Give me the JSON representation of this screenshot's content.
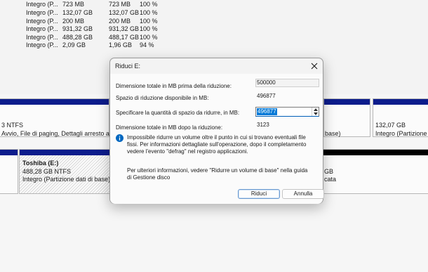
{
  "volumes": {
    "rows": [
      {
        "status": "Integro (P...",
        "capacity": "723 MB",
        "free": "723 MB",
        "pct": "100 %"
      },
      {
        "status": "Integro (P...",
        "capacity": "132,07 GB",
        "free": "132,07 GB",
        "pct": "100 %"
      },
      {
        "status": "Integro (P...",
        "capacity": "200 MB",
        "free": "200 MB",
        "pct": "100 %"
      },
      {
        "status": "Integro (P...",
        "capacity": "931,32 GB",
        "free": "931,32 GB",
        "pct": "100 %"
      },
      {
        "status": "Integro (P...",
        "capacity": "488,28 GB",
        "free": "488,17 GB",
        "pct": "100 %"
      },
      {
        "status": "Integro (P...",
        "capacity": "2,09 GB",
        "free": "1,96 GB",
        "pct": "94 %"
      }
    ]
  },
  "disk_map": {
    "disk0": {
      "c_line1": "3 NTFS",
      "c_line2": "Avvio, File di paging, Dettagli arresto anoma",
      "mid_line2": "base)",
      "right_size": "132,07 GB",
      "right_status": "Integro (Partizione pr"
    },
    "disk1": {
      "name": "Toshiba  (E:)",
      "size": "488,28 GB NTFS",
      "status": "Integro (Partizione dati di base)",
      "right_line1": "GB",
      "right_line2": "cata"
    }
  },
  "dialog": {
    "title": "Riduci E:",
    "fields": {
      "total_before_label": "Dimensione totale in MB prima della riduzione:",
      "total_before_value": "500000",
      "available_label": "Spazio di riduzione disponibile in MB:",
      "available_value": "496877",
      "amount_label": "Specificare la quantità di spazio da ridurre, in MB:",
      "amount_value": "496877",
      "total_after_label": "Dimensione totale in MB dopo la riduzione:",
      "total_after_value": "3123"
    },
    "info_text": "Impossibile ridurre un volume oltre il punto in cui si trovano eventuali file fissi. Per informazioni dettagliate sull'operazione, dopo il completamento vedere l'evento \"defrag\" nel registro applicazioni.",
    "help_text": "Per ulteriori informazioni, vedere \"Ridurre un volume di base\" nella guida di Gestione disco",
    "buttons": {
      "shrink": "Riduci",
      "cancel": "Annulla"
    }
  },
  "colors": {
    "partition_bar": "#0c1c8c",
    "selection": "#0078d7",
    "info_icon": "#0067c0"
  }
}
